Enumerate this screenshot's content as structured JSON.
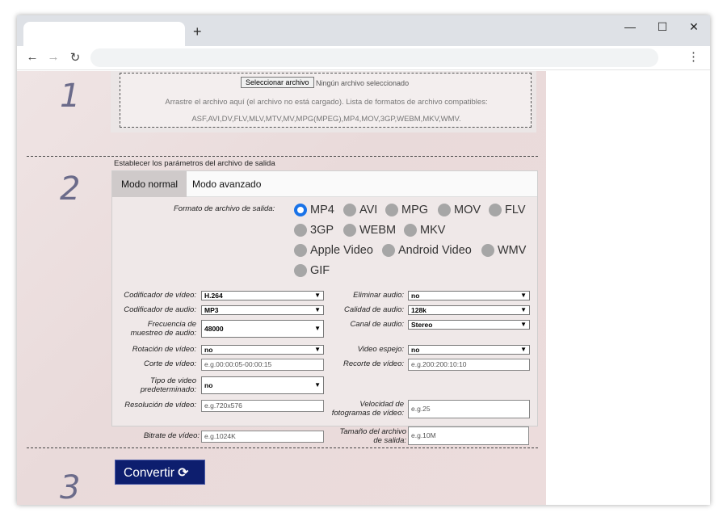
{
  "browser": {
    "new_tab": "+",
    "window_controls": {
      "minimize": "—",
      "maximize": "☐",
      "close": "✕"
    },
    "nav": {
      "back": "←",
      "forward": "→",
      "reload": "↻",
      "menu": "⋮"
    }
  },
  "steps": {
    "one": "1",
    "two": "2",
    "three": "3"
  },
  "upload": {
    "button_label": "Seleccionar archivo",
    "no_file": "Ningún archivo seleccionado",
    "drag_text": "Arrastre el archivo aquí (el archivo no está cargado). Lista de formatos de archivo compatibles:",
    "formats": "ASF,AVI,DV,FLV,MLV,MTV,MV,MPG(MPEG),MP4,MOV,3GP,WEBM,MKV,WMV."
  },
  "settings": {
    "heading": "Establecer los parámetros del archivo de salida",
    "tabs": {
      "normal": "Modo normal",
      "advanced": "Modo avanzado"
    },
    "format_label": "Formato de archivo de salida:",
    "formats": [
      "MP4",
      "AVI",
      "MPG",
      "MOV",
      "FLV",
      "3GP",
      "WEBM",
      "MKV",
      "Apple Video",
      "Android Video",
      "WMV",
      "GIF"
    ],
    "selected_format": "MP4",
    "fields": {
      "video_codec": {
        "label": "Codificador de vídeo:",
        "value": "H.264"
      },
      "audio_codec": {
        "label": "Codificador de audio:",
        "value": "MP3"
      },
      "sample_rate": {
        "label1": "Frecuencia de",
        "label2": "muestreo de audio:",
        "value": "48000"
      },
      "rotation": {
        "label": "Rotación de vídeo:",
        "value": "no"
      },
      "cut": {
        "label": "Corte de vídeo:",
        "placeholder": "e.g.00:00:05-00:00:15"
      },
      "preset": {
        "label1": "Tipo de video",
        "label2": "predeterminado:",
        "value": "no"
      },
      "resolution": {
        "label": "Resolución de vídeo:",
        "placeholder": "e.g.720x576"
      },
      "bitrate": {
        "label": "Bitrate de vídeo:",
        "placeholder": "e.g.1024K"
      },
      "remove_audio": {
        "label": "Eliminar audio:",
        "value": "no"
      },
      "audio_quality": {
        "label": "Calidad de audio:",
        "value": "128k"
      },
      "audio_channel": {
        "label": "Canal de audio:",
        "value": "Stereo"
      },
      "mirror": {
        "label": "Video espejo:",
        "value": "no"
      },
      "crop": {
        "label": "Recorte de vídeo:",
        "placeholder": "e.g.200:200:10:10"
      },
      "fps": {
        "label1": "Velocidad de",
        "label2": "fotogramas de vídeo:",
        "placeholder": "e.g.25"
      },
      "output_size": {
        "label1": "Tamaño del archivo",
        "label2": "de salida:",
        "placeholder": "e.g.10M"
      }
    }
  },
  "convert": {
    "label": "Convertir",
    "icon": "⟳"
  },
  "colors": {
    "accent": "#1a73e8",
    "convert_bg": "#0d1e6e"
  }
}
